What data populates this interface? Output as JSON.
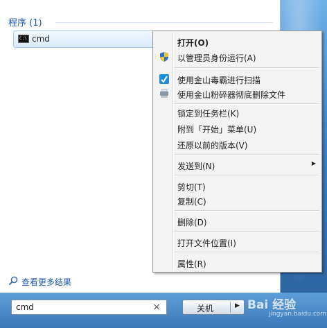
{
  "start_menu": {
    "group_header": "程序 (1)",
    "results": [
      {
        "label": "cmd",
        "icon": "cmd-icon"
      }
    ],
    "see_more": "查看更多结果",
    "search_value": "cmd",
    "clear_symbol": "×",
    "shutdown_label": "关机",
    "shutdown_arrow": "▶"
  },
  "context_menu": {
    "items": [
      {
        "label": "打开(O)",
        "bold": true
      },
      {
        "label": "以管理员身份运行(A)",
        "icon": "uac-shield-icon"
      },
      {
        "label": "使用金山毒霸进行扫描",
        "icon": "kingsoft-antivirus-icon"
      },
      {
        "label": "使用金山粉碎器彻底删除文件",
        "icon": "shredder-icon"
      },
      {
        "label": "锁定到任务栏(K)"
      },
      {
        "label": "附到「开始」菜单(U)"
      },
      {
        "label": "还原以前的版本(V)"
      },
      {
        "label": "发送到(N)",
        "submenu_arrow": "▶"
      },
      {
        "label": "剪切(T)"
      },
      {
        "label": "复制(C)"
      },
      {
        "label": "删除(D)"
      },
      {
        "label": "打开文件位置(I)"
      },
      {
        "label": "属性(R)"
      }
    ]
  },
  "watermark": {
    "text": "Bai 经验",
    "sub": "jingyan.baidu.com"
  },
  "colors": {
    "link_blue": "#1e5aa8",
    "accent": "#3a78b8"
  }
}
